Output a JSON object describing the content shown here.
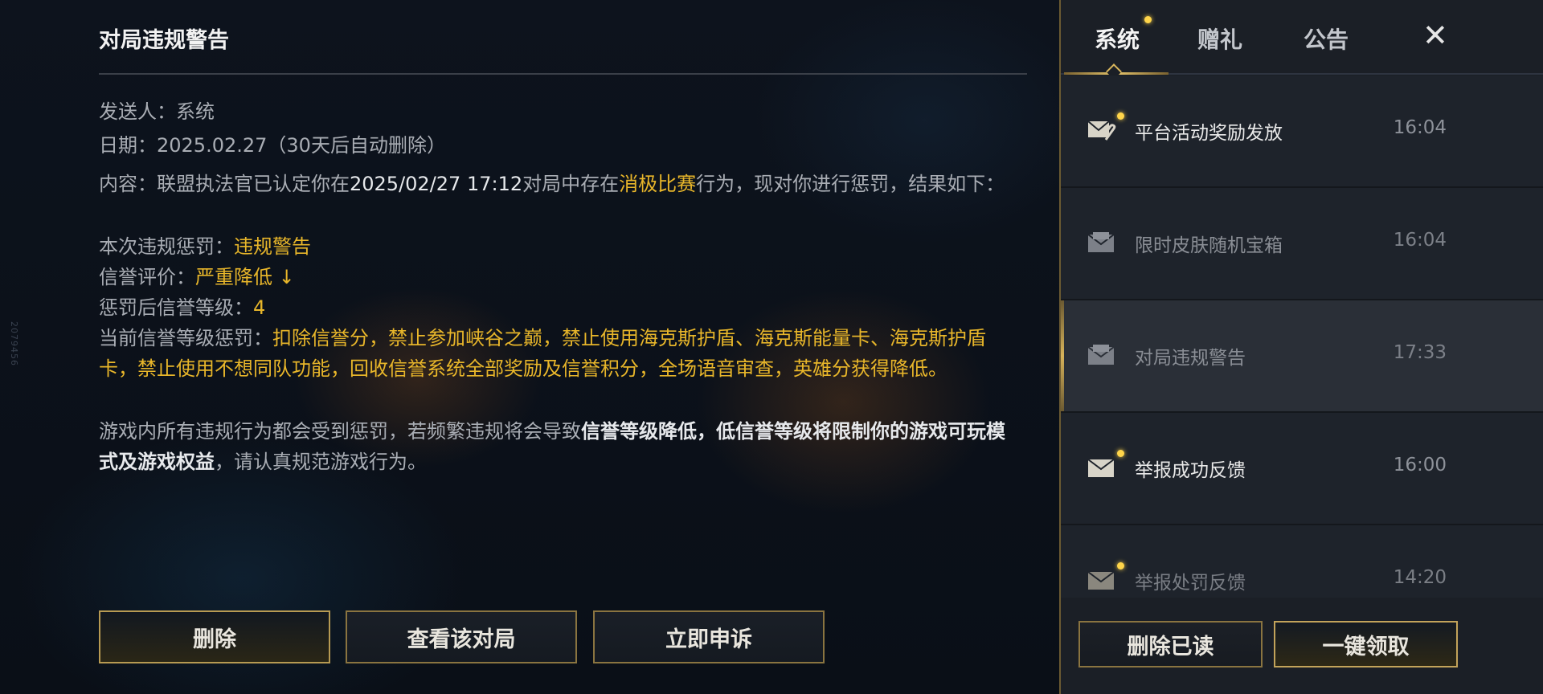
{
  "side_id": "2079456",
  "detail": {
    "title": "对局违规警告",
    "sender_label": "发送人：",
    "sender_value": "系统",
    "date_label": "日期：",
    "date_value": "2025.02.27（30天后自动删除）",
    "content": {
      "intro_1": "内容：联盟执法官已认定你在",
      "intro_time": "2025/02/27 17:12",
      "intro_2": "对局中存在",
      "intro_behavior": "消极比赛",
      "intro_3": "行为，现对你进行惩罚，结果如下：",
      "penalty_label": "本次违规惩罚：",
      "penalty_value": "违规警告",
      "credit_label": "信誉评价：",
      "credit_value": "严重降低 ↓",
      "level_label": "惩罚后信誉等级：",
      "level_value": "4",
      "current_label": "当前信誉等级惩罚：",
      "current_value": "扣除信誉分，禁止参加峡谷之巅，禁止使用海克斯护盾、海克斯能量卡、海克斯护盾卡，禁止使用不想同队功能，回收信誉系统全部奖励及信誉积分，全场语音审查，英雄分获得降低。",
      "footer_1": "游戏内所有违规行为都会受到惩罚，若频繁违规将会导致",
      "footer_bold": "信誉等级降低，低信誉等级将限制你的游戏可玩模式及游戏权益",
      "footer_2": "，请认真规范游戏行为。"
    },
    "buttons": {
      "delete": "删除",
      "view_match": "查看该对局",
      "appeal": "立即申诉"
    }
  },
  "panel": {
    "tabs": [
      {
        "label": "系统",
        "active": true,
        "has_badge": true
      },
      {
        "label": "赠礼",
        "active": false,
        "has_badge": false
      },
      {
        "label": "公告",
        "active": false,
        "has_badge": false
      }
    ],
    "close_icon": "close-icon",
    "messages": [
      {
        "title": "平台活动奖励发放",
        "time": "16:04",
        "icon": "mail-attachment-icon",
        "unread": true
      },
      {
        "title": "限时皮肤随机宝箱",
        "time": "16:04",
        "icon": "mail-opened-icon",
        "unread": false
      },
      {
        "title": "对局违规警告",
        "time": "17:33",
        "icon": "mail-opened-icon",
        "unread": false,
        "selected": true
      },
      {
        "title": "举报成功反馈",
        "time": "16:00",
        "icon": "mail-icon",
        "unread": true
      },
      {
        "title": "举报处罚反馈",
        "time": "14:20",
        "icon": "mail-icon",
        "unread": true
      }
    ],
    "buttons": {
      "delete_read": "删除已读",
      "claim_all": "一键领取"
    }
  },
  "colors": {
    "accent_gold": "#e8b62a",
    "border_gold": "#8a7440",
    "badge": "#ffd54a"
  }
}
